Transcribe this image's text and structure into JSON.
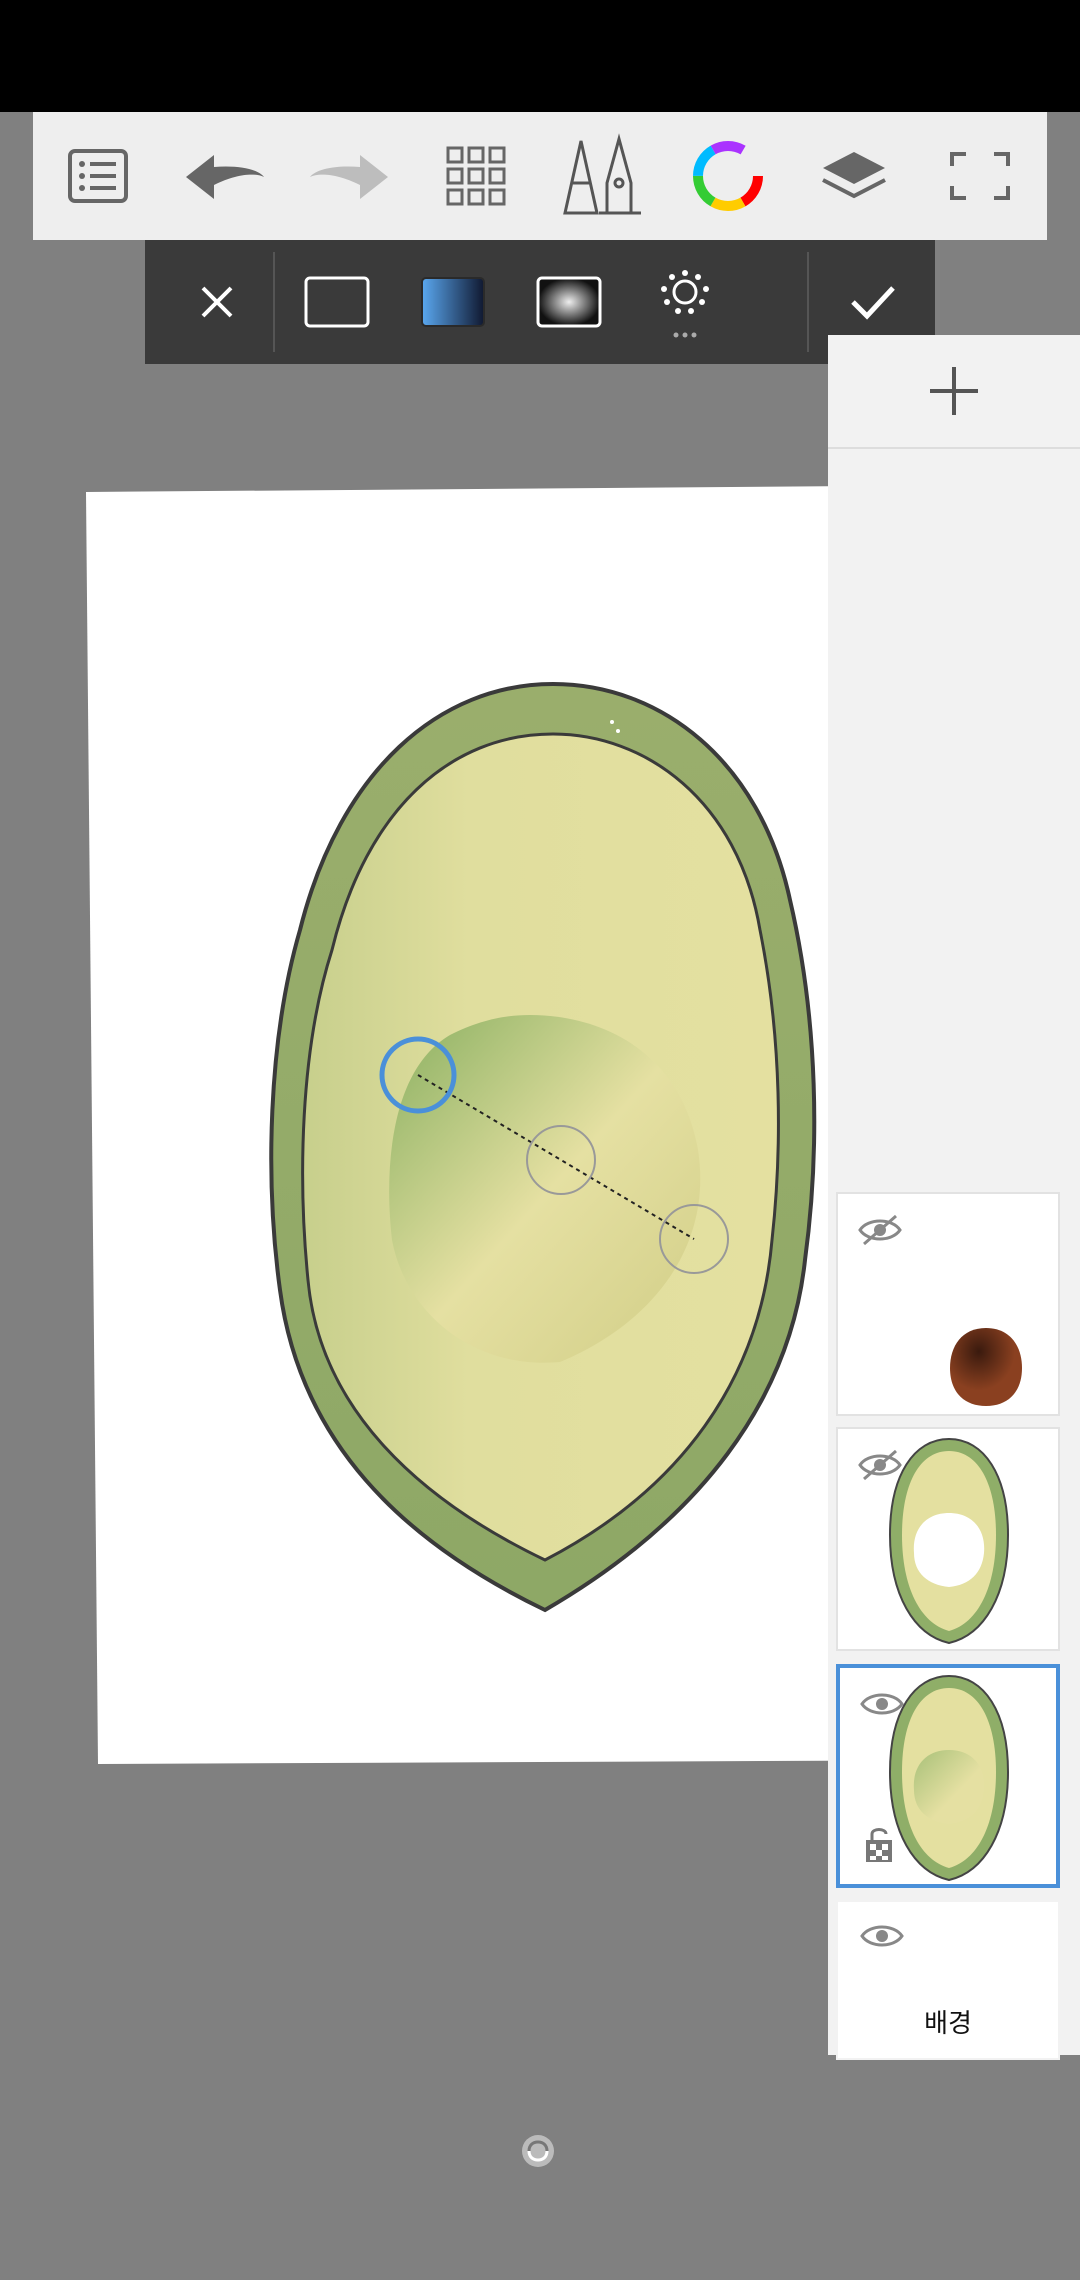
{
  "toolbar": {
    "items": [
      "list-icon",
      "undo-icon",
      "redo-icon",
      "grid-icon",
      "brush-tools-icon",
      "color-wheel-icon",
      "layers-icon",
      "fullscreen-icon"
    ]
  },
  "fill_bar": {
    "items": [
      "close-icon",
      "solid-fill-icon",
      "linear-gradient-icon",
      "radial-gradient-icon",
      "fill-settings-icon",
      "confirm-icon"
    ],
    "selected": "linear-gradient-icon"
  },
  "layers": {
    "items": [
      {
        "name": "",
        "visible": false,
        "thumbnail": "brown-pit"
      },
      {
        "name": "",
        "visible": false,
        "thumbnail": "avocado-hole"
      },
      {
        "name": "",
        "visible": true,
        "thumbnail": "avocado-gradient",
        "selected": true,
        "locked_alpha": true
      },
      {
        "name": "배경",
        "visible": true,
        "thumbnail": "background"
      }
    ]
  },
  "colors": {
    "accent": "#4a90d9",
    "outer_skin": "#8fae68",
    "flesh": "#e4e0a0",
    "pit": "#5a2a14"
  }
}
